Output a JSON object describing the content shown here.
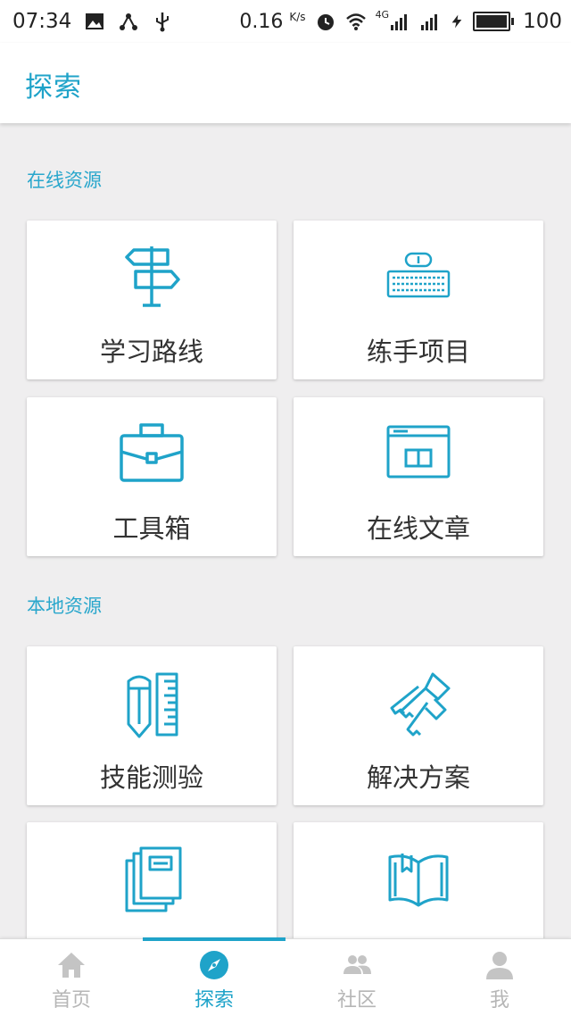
{
  "status_bar": {
    "time": "07:34",
    "speed": "0.16",
    "speed_unit": "K/s",
    "network": "4G",
    "battery": "100"
  },
  "appbar": {
    "title": "探索"
  },
  "sections": {
    "online": {
      "label": "在线资源",
      "items": [
        {
          "label": "学习路线",
          "icon": "signpost-icon"
        },
        {
          "label": "练手项目",
          "icon": "keyboard-icon"
        },
        {
          "label": "工具箱",
          "icon": "toolbox-icon"
        },
        {
          "label": "在线文章",
          "icon": "web-article-icon"
        }
      ]
    },
    "local": {
      "label": "本地资源",
      "items": [
        {
          "label": "技能测验",
          "icon": "pencil-ruler-icon"
        },
        {
          "label": "解决方案",
          "icon": "keys-icon"
        },
        {
          "label": "",
          "icon": "books-icon"
        },
        {
          "label": "",
          "icon": "open-book-icon"
        }
      ]
    }
  },
  "bottom_nav": {
    "items": [
      {
        "label": "首页",
        "icon": "home-icon"
      },
      {
        "label": "探索",
        "icon": "compass-icon"
      },
      {
        "label": "社区",
        "icon": "community-icon"
      },
      {
        "label": "我",
        "icon": "user-icon"
      }
    ],
    "active_index": 1
  },
  "colors": {
    "accent": "#1fa3c9",
    "background": "#efeeef",
    "inactive": "#b6b6b6"
  }
}
